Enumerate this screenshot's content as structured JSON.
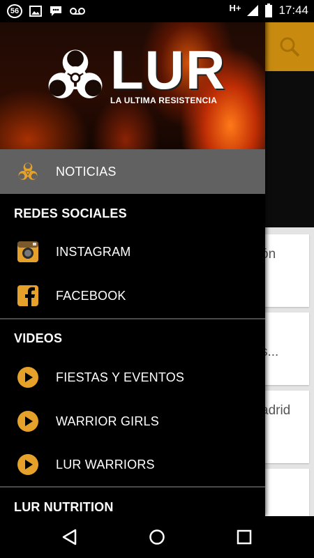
{
  "status_bar": {
    "notification_count": "56",
    "network": "H+",
    "time": "17:44"
  },
  "drawer": {
    "logo_title": "LUR",
    "logo_subtitle": "LA ULTIMA RESISTENCIA",
    "active_item": {
      "label": "NOTICIAS",
      "icon": "biohazard-icon"
    },
    "sections": [
      {
        "title": "REDES SOCIALES",
        "items": [
          {
            "label": "INSTAGRAM",
            "icon": "instagram-icon"
          },
          {
            "label": "FACEBOOK",
            "icon": "facebook-icon"
          }
        ]
      },
      {
        "title": "VIDEOS",
        "items": [
          {
            "label": "FIESTAS Y EVENTOS",
            "icon": "play-icon"
          },
          {
            "label": "WARRIOR GIRLS",
            "icon": "play-icon"
          },
          {
            "label": "LUR WARRIORS",
            "icon": "play-icon"
          }
        ]
      },
      {
        "title": "LUR NUTRITION",
        "items": []
      }
    ]
  },
  "background": {
    "cards": [
      "ón",
      "s...",
      "adrid",
      ""
    ]
  },
  "colors": {
    "accent": "#e5a12a",
    "active_bg": "#616161",
    "search_bg": "#c98a10"
  }
}
